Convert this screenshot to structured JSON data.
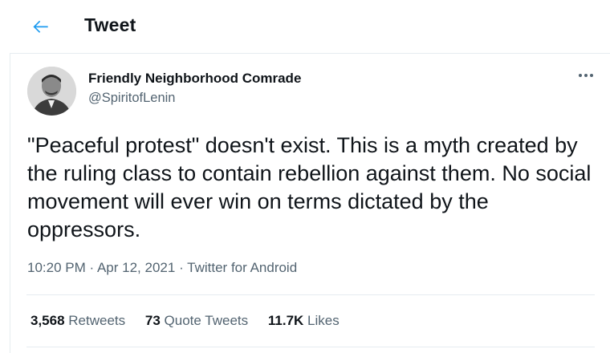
{
  "header": {
    "title": "Tweet",
    "back_icon": "arrow-left-icon",
    "accent": "#1d9bf0"
  },
  "author": {
    "name": "Friendly Neighborhood Comrade",
    "handle": "@SpiritofLenin"
  },
  "tweet": {
    "text": "\"Peaceful protest\" doesn't exist. This is a myth created by the ruling class to contain rebellion against them. No social movement will ever win on terms dictated by the oppressors.",
    "time": "10:20 PM",
    "date": "Apr 12, 2021",
    "source": "Twitter for Android",
    "separator": "·"
  },
  "stats": [
    {
      "count": "3,568",
      "label": "Retweets"
    },
    {
      "count": "73",
      "label": "Quote Tweets"
    },
    {
      "count": "11.7K",
      "label": "Likes"
    }
  ]
}
